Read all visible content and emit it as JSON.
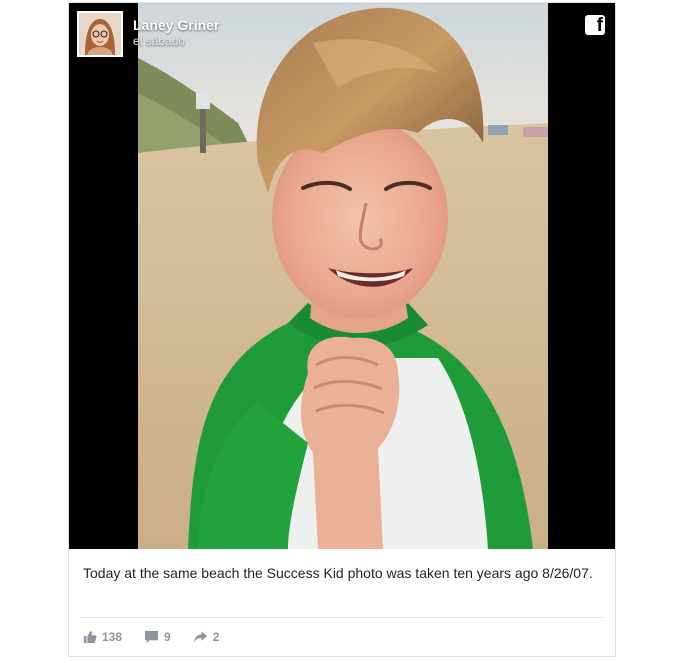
{
  "post": {
    "author": "Laney Griner",
    "timestamp": "el sábado",
    "caption": "Today at the same beach the Success Kid photo was taken ten years ago 8/26/07.",
    "brand_icon": "facebook-icon"
  },
  "stats": {
    "likes": "138",
    "comments": "9",
    "shares": "2"
  },
  "colors": {
    "accent": "#3b5998",
    "meta_text": "#90949c",
    "body_text": "#1d2129",
    "shirt_green": "#1f9b3a"
  }
}
